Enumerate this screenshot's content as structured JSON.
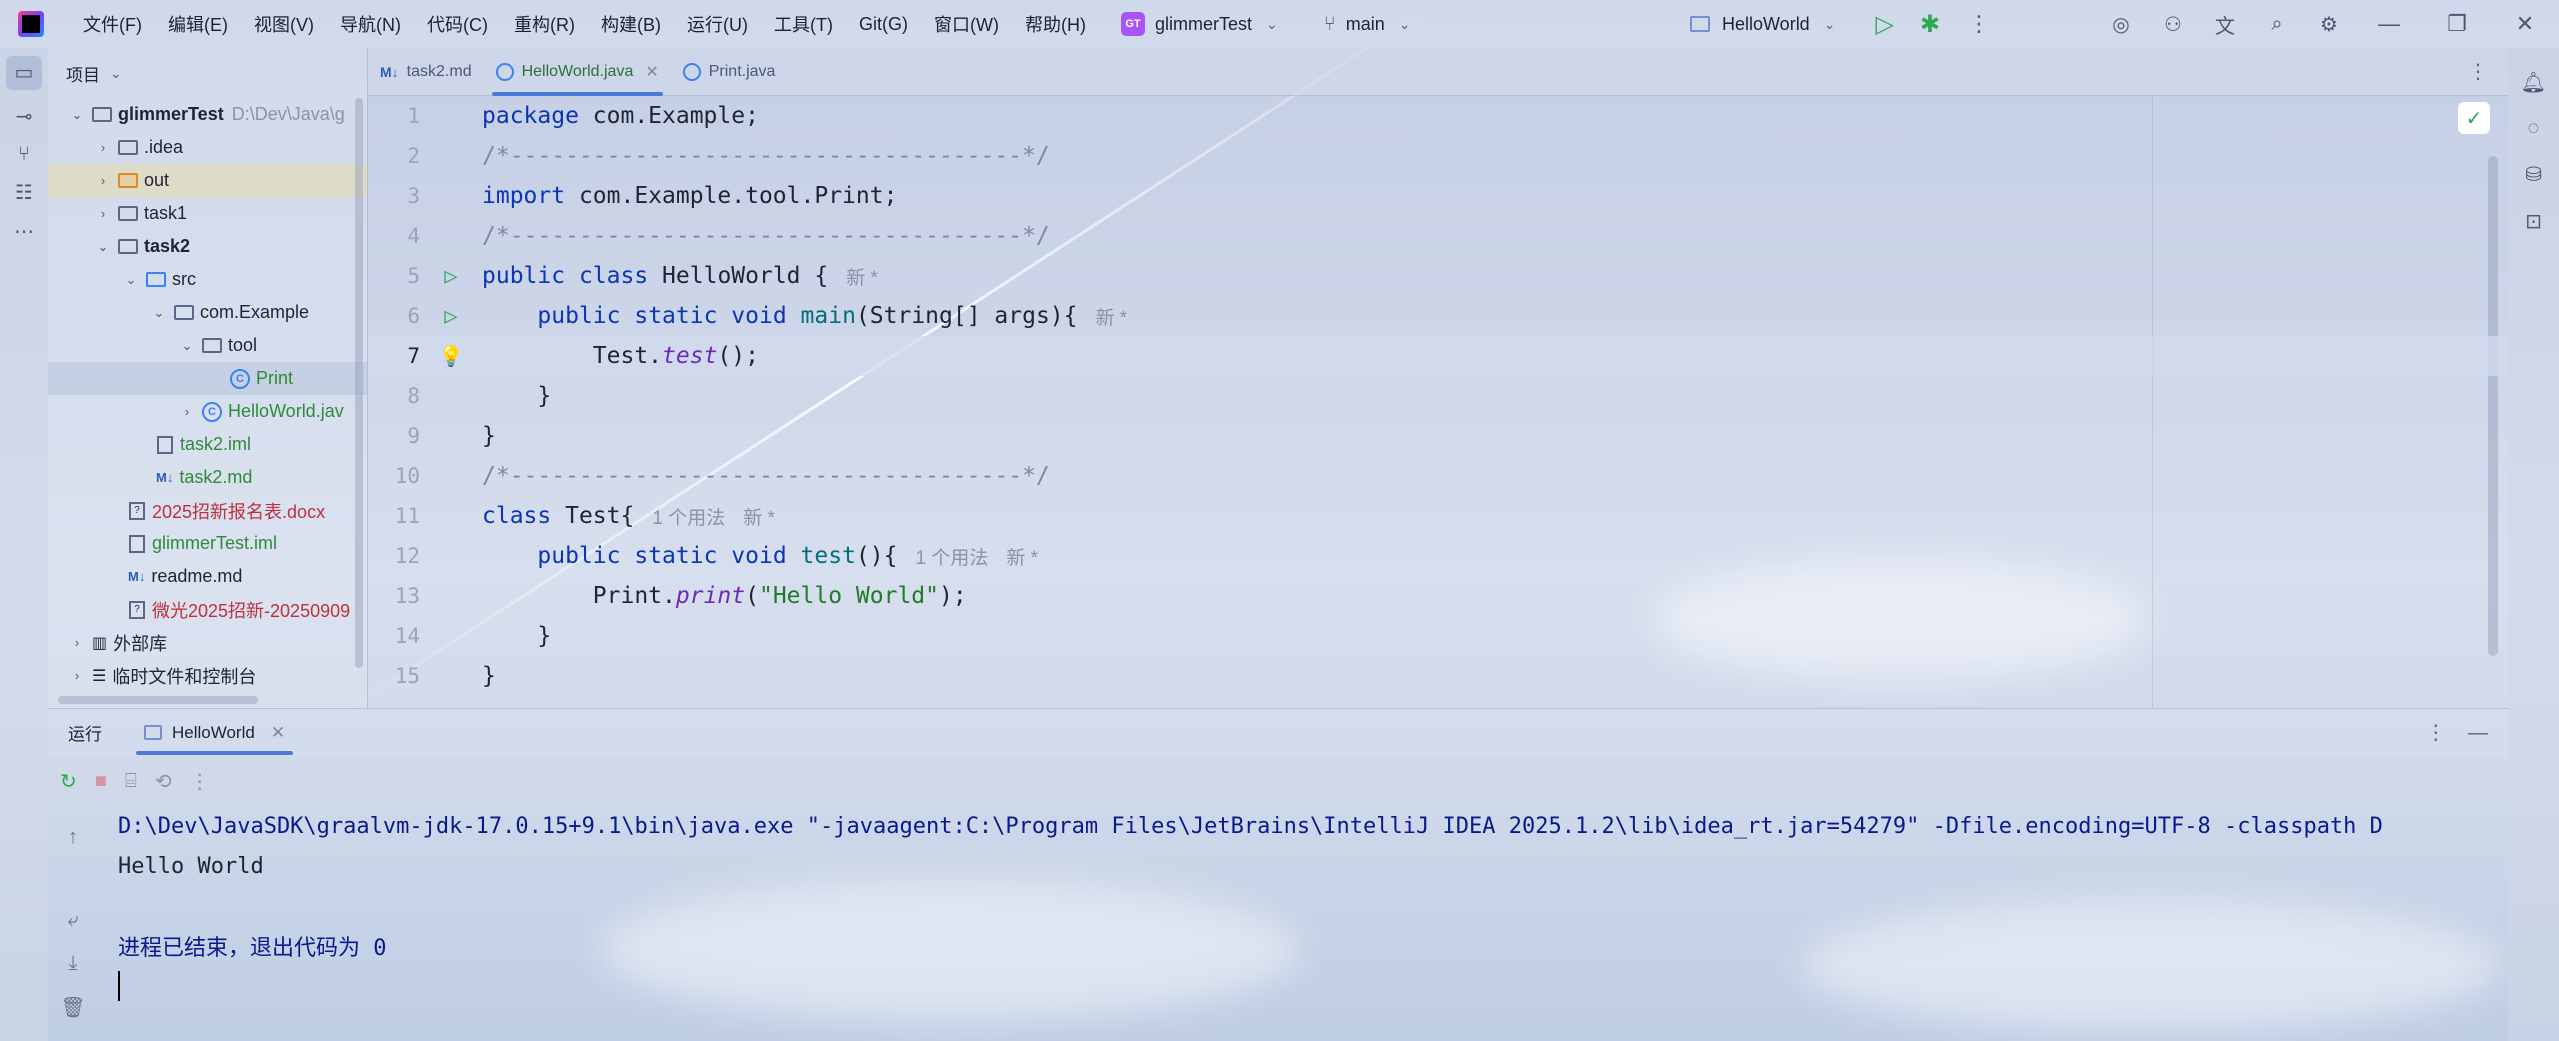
{
  "titlebar": {
    "menus": [
      "文件(F)",
      "编辑(E)",
      "视图(V)",
      "导航(N)",
      "代码(C)",
      "重构(R)",
      "构建(B)",
      "运行(U)",
      "工具(T)",
      "Git(G)",
      "窗口(W)",
      "帮助(H)"
    ],
    "project_badge": "GT",
    "project_name": "glimmerTest",
    "branch": "main",
    "run_config": "HelloWorld"
  },
  "project_panel": {
    "title": "项目",
    "tree": [
      {
        "label": "glimmerTest",
        "path": "D:\\Dev\\Java\\g"
      },
      {
        "label": ".idea"
      },
      {
        "label": "out"
      },
      {
        "label": "task1"
      },
      {
        "label": "task2"
      },
      {
        "label": "src"
      },
      {
        "label": "com.Example"
      },
      {
        "label": "tool"
      },
      {
        "label": "Print"
      },
      {
        "label": "HelloWorld.jav"
      },
      {
        "label": "task2.iml"
      },
      {
        "label": "task2.md"
      },
      {
        "label": "2025招新报名表.docx"
      },
      {
        "label": "glimmerTest.iml"
      },
      {
        "label": "readme.md"
      },
      {
        "label": "微光2025招新-20250909"
      },
      {
        "label": "外部库"
      },
      {
        "label": "临时文件和控制台"
      }
    ]
  },
  "editor_tabs": [
    {
      "label": "task2.md",
      "icon": "markdown-icon"
    },
    {
      "label": "HelloWorld.java",
      "icon": "class-icon",
      "active": true
    },
    {
      "label": "Print.java",
      "icon": "class-icon"
    }
  ],
  "code": {
    "line_numbers": [
      "1",
      "2",
      "3",
      "4",
      "5",
      "6",
      "7",
      "8",
      "9",
      "10",
      "11",
      "12",
      "13",
      "14",
      "15"
    ],
    "l1_kw": "package",
    "l1_rest": " com.Example;",
    "l2": "/*-------------------------------------*/",
    "l3_kw": "import",
    "l3_rest": " com.Example.tool.Print;",
    "l4": "/*-------------------------------------*/",
    "l5_kw1": "public",
    "l5_kw2": "class",
    "l5_rest": " HelloWorld {",
    "l5_hint": "新 *",
    "l6_kw1": "public",
    "l6_kw2": "static",
    "l6_kw3": "void",
    "l6_fn": "main",
    "l6_rest": "(String[] args){",
    "l6_hint": "新 *",
    "l7_a": "Test.",
    "l7_it": "test",
    "l7_b": "();",
    "l8": "}",
    "l9": "}",
    "l10": "/*-------------------------------------*/",
    "l11_kw": "class",
    "l11_rest": " Test{",
    "l11_hint1": "1 个用法",
    "l11_hint2": "新 *",
    "l12_kw1": "public",
    "l12_kw2": "static",
    "l12_kw3": "void",
    "l12_fn": "test",
    "l12_rest": "(){",
    "l12_hint1": "1 个用法",
    "l12_hint2": "新 *",
    "l13_a": "Print.",
    "l13_it": "print",
    "l13_p1": "(",
    "l13_str": "\"Hello World\"",
    "l13_p2": ");",
    "l14": "}",
    "l15": "}"
  },
  "run_panel": {
    "title": "运行",
    "tab": "HelloWorld",
    "console": {
      "command": "D:\\Dev\\JavaSDK\\graalvm-jdk-17.0.15+9.1\\bin\\java.exe \"-javaagent:C:\\Program Files\\JetBrains\\IntelliJ IDEA 2025.1.2\\lib\\idea_rt.jar=54279\" -Dfile.encoding=UTF-8 -classpath D",
      "output": "Hello World",
      "exit": "进程已结束，退出代码为 0"
    }
  },
  "colors": {
    "keyword": "#0b35b3",
    "string": "#1f7a2a",
    "run_green": "#2fa84f",
    "accent": "#4a7bd8"
  }
}
